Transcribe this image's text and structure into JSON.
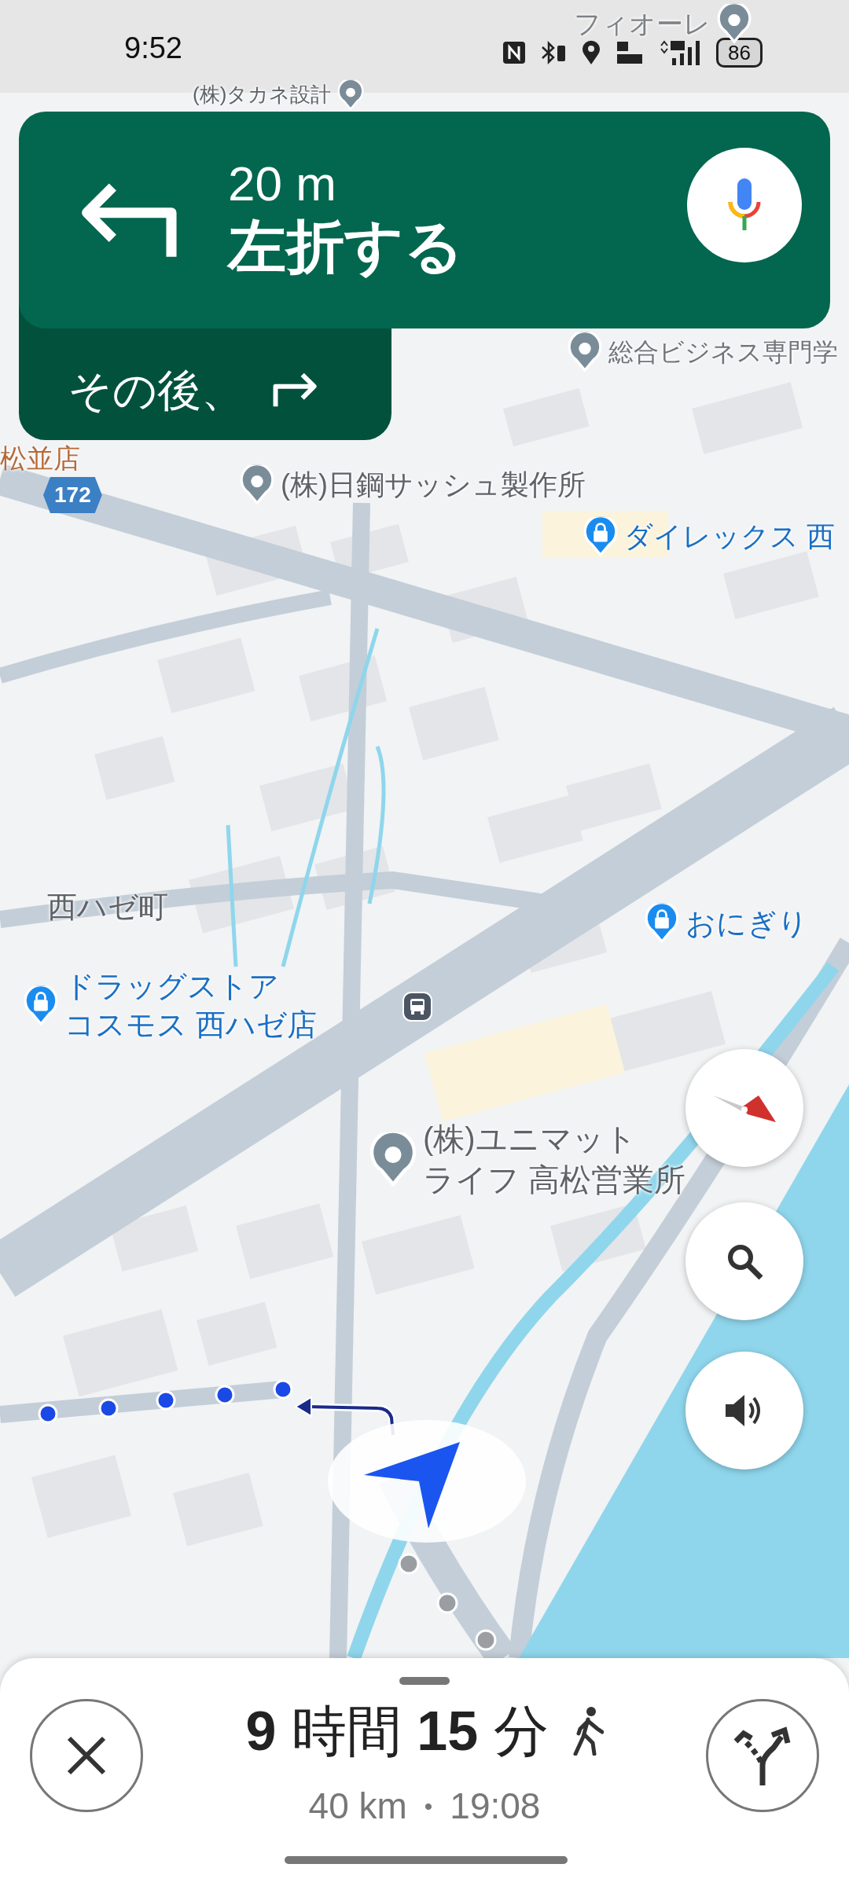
{
  "status_bar": {
    "time": "9:52",
    "battery": "86"
  },
  "navigation": {
    "distance": "20 m",
    "instruction": "左折する",
    "then_label": "その後、"
  },
  "map": {
    "places": [
      {
        "name": "フィオーレ",
        "kind": "company"
      },
      {
        "name": "(株)タカネ設計",
        "kind": "company"
      },
      {
        "name": "総合ビジネス専門学",
        "kind": "school"
      },
      {
        "name": "松並店",
        "kind": "food"
      },
      {
        "name": "172",
        "kind": "route"
      },
      {
        "name": "(株)日鋼サッシュ製作所",
        "kind": "company"
      },
      {
        "name": "ダイレックス 西",
        "kind": "shop"
      },
      {
        "name": "西ハゼ町",
        "kind": "area"
      },
      {
        "name": "おにぎり",
        "kind": "shop"
      },
      {
        "name_lines": [
          "ドラッグストア",
          "コスモス 西ハゼ店"
        ],
        "kind": "shop"
      },
      {
        "name_lines": [
          "(株)ユニマット",
          "ライフ 高松営業所"
        ],
        "kind": "company"
      }
    ]
  },
  "trip": {
    "duration": "**9** 時間 **15** 分",
    "distance": "40 km",
    "separator": "•",
    "arrival": "19:08"
  }
}
